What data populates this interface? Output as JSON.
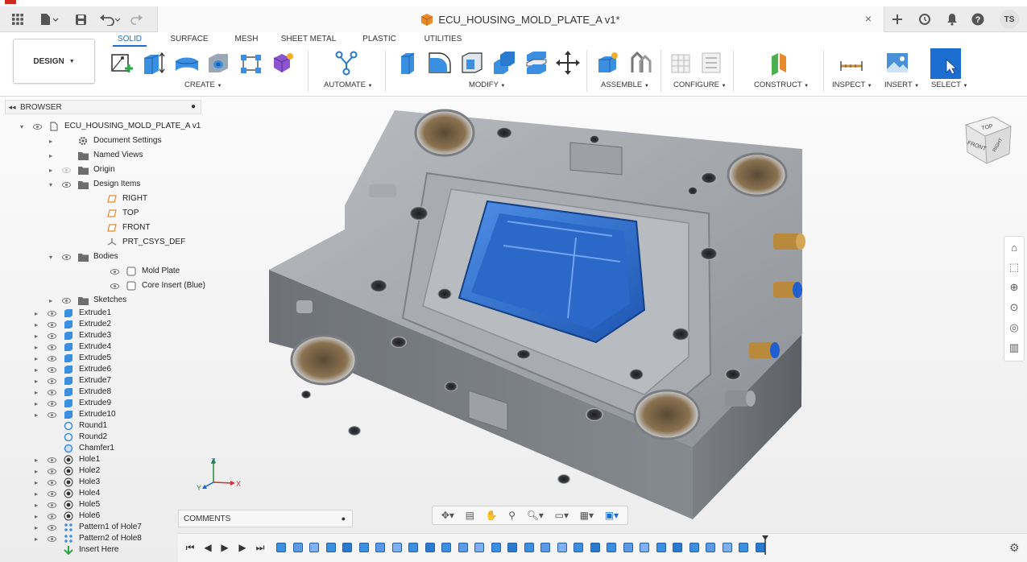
{
  "app_bar": {
    "brand_color": "#d02a1e"
  },
  "titlebar": {
    "document_title": "ECU_HOUSING_MOLD_PLATE_A v1*",
    "close_label": "×",
    "user_initials": "TS",
    "icons": [
      "grid-icon",
      "file-icon",
      "save-icon",
      "undo-icon",
      "redo-icon",
      "cube-icon",
      "plus-icon",
      "refresh-icon",
      "bell-icon",
      "help-icon"
    ]
  },
  "ribbon": {
    "workspace": "DESIGN",
    "tabs": [
      {
        "label": "SOLID",
        "active": true
      },
      {
        "label": "SURFACE",
        "active": false
      },
      {
        "label": "MESH",
        "active": false
      },
      {
        "label": "SHEET METAL",
        "active": false
      },
      {
        "label": "PLASTIC",
        "active": false
      },
      {
        "label": "UTILITIES",
        "active": false
      }
    ],
    "groups": {
      "create": "CREATE",
      "automate": "AUTOMATE",
      "modify": "MODIFY",
      "assemble": "ASSEMBLE",
      "configure": "CONFIGURE",
      "construct": "CONSTRUCT",
      "inspect": "INSPECT",
      "insert": "INSERT",
      "select": "SELECT"
    },
    "accent_color": "#1c6fd0"
  },
  "browser": {
    "title": "BROWSER",
    "rows": [
      {
        "label": "ECU_HOUSING_MOLD_PLATE_A v1",
        "icon": "document-icon"
      },
      {
        "label": "Document Settings",
        "icon": "gear-icon"
      },
      {
        "label": "Named Views",
        "icon": "folder-icon"
      },
      {
        "label": "Origin",
        "icon": "folder-icon"
      },
      {
        "label": "Design Items",
        "icon": "folder-icon"
      },
      {
        "label": "RIGHT",
        "icon": "plane-icon"
      },
      {
        "label": "TOP",
        "icon": "plane-icon"
      },
      {
        "label": "FRONT",
        "icon": "plane-icon"
      },
      {
        "label": "PRT_CSYS_DEF",
        "icon": "csys-icon"
      },
      {
        "label": "Bodies",
        "icon": "folder-icon"
      },
      {
        "label": "Mold Plate",
        "icon": "body-icon"
      },
      {
        "label": "Core Insert (Blue)",
        "icon": "body-icon"
      },
      {
        "label": "Sketches",
        "icon": "folder-icon"
      },
      {
        "label": "Extrude1",
        "icon": "extrude-icon"
      },
      {
        "label": "Extrude2",
        "icon": "extrude-icon"
      },
      {
        "label": "Extrude3",
        "icon": "extrude-icon"
      },
      {
        "label": "Extrude4",
        "icon": "extrude-icon"
      },
      {
        "label": "Extrude5",
        "icon": "extrude-icon"
      },
      {
        "label": "Extrude6",
        "icon": "extrude-icon"
      },
      {
        "label": "Extrude7",
        "icon": "extrude-icon"
      },
      {
        "label": "Extrude8",
        "icon": "extrude-icon"
      },
      {
        "label": "Extrude9",
        "icon": "extrude-icon"
      },
      {
        "label": "Extrude10",
        "icon": "extrude-icon"
      },
      {
        "label": "Round1",
        "icon": "fillet-icon"
      },
      {
        "label": "Round2",
        "icon": "fillet-icon"
      },
      {
        "label": "Chamfer1",
        "icon": "chamfer-icon"
      },
      {
        "label": "Hole1",
        "icon": "hole-icon"
      },
      {
        "label": "Hole2",
        "icon": "hole-icon"
      },
      {
        "label": "Hole3",
        "icon": "hole-icon"
      },
      {
        "label": "Hole4",
        "icon": "hole-icon"
      },
      {
        "label": "Hole5",
        "icon": "hole-icon"
      },
      {
        "label": "Hole6",
        "icon": "hole-icon"
      },
      {
        "label": "Pattern1 of Hole7",
        "icon": "pattern-icon"
      },
      {
        "label": "Pattern2 of Hole8",
        "icon": "pattern-icon"
      },
      {
        "label": "Insert Here",
        "icon": "insert-marker-icon"
      }
    ]
  },
  "viewcube": {
    "top": "TOP",
    "front": "FRONT",
    "right": "RIGHT"
  },
  "comments": {
    "label": "COMMENTS"
  },
  "axes": {
    "x": "X",
    "y": "Y",
    "z": "Z"
  },
  "timeline": {
    "feature_count": 30
  },
  "model": {
    "plate_color": "#8e9196",
    "insert_color": "#2f6fd1"
  }
}
